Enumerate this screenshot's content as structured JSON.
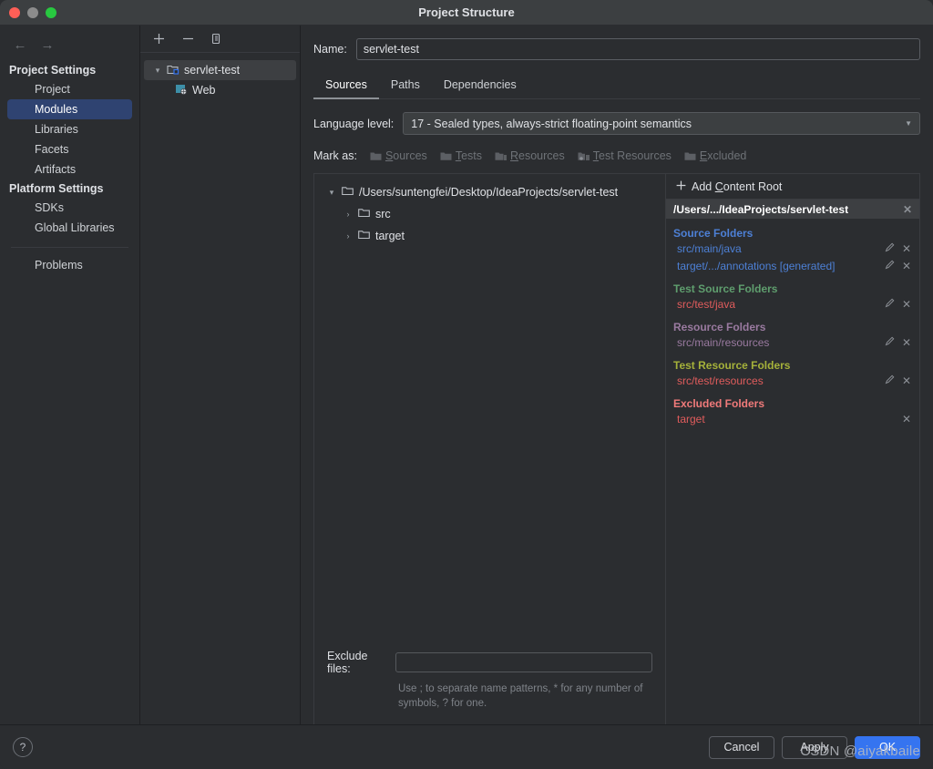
{
  "window": {
    "title": "Project Structure",
    "traffic_lights": [
      "close-button",
      "minimize-button",
      "maximize-button"
    ]
  },
  "sidebar": {
    "back_icon": "←",
    "forward_icon": "→",
    "groups": [
      {
        "label": "Project Settings",
        "items": [
          {
            "label": "Project",
            "selected": false
          },
          {
            "label": "Modules",
            "selected": true
          },
          {
            "label": "Libraries",
            "selected": false
          },
          {
            "label": "Facets",
            "selected": false
          },
          {
            "label": "Artifacts",
            "selected": false
          }
        ]
      },
      {
        "label": "Platform Settings",
        "items": [
          {
            "label": "SDKs",
            "selected": false
          },
          {
            "label": "Global Libraries",
            "selected": false
          }
        ]
      }
    ],
    "problems_label": "Problems"
  },
  "modules_panel": {
    "toolbar": {
      "add_label": "+",
      "remove_label": "−",
      "copy_label": "copy-icon"
    },
    "tree": [
      {
        "label": "servlet-test",
        "level": 1,
        "expanded": true,
        "selected": true,
        "icon": "module-icon"
      },
      {
        "label": "Web",
        "level": 2,
        "expanded": false,
        "selected": false,
        "icon": "web-facet-icon"
      }
    ]
  },
  "main": {
    "name_label": "Name:",
    "name_value": "servlet-test",
    "tabs": [
      {
        "label": "Sources",
        "active": true
      },
      {
        "label": "Paths",
        "active": false
      },
      {
        "label": "Dependencies",
        "active": false
      }
    ],
    "language_level_label": "Language level:",
    "language_level_value": "17 - Sealed types, always-strict floating-point semantics",
    "mark_as_label": "Mark as:",
    "mark_as_buttons": [
      {
        "pre": "",
        "mnemonic": "S",
        "post": "ources",
        "icon": "folder-sources-icon"
      },
      {
        "pre": "",
        "mnemonic": "T",
        "post": "ests",
        "icon": "folder-tests-icon"
      },
      {
        "pre": "",
        "mnemonic": "R",
        "post": "esources",
        "icon": "folder-resources-icon"
      },
      {
        "pre": "",
        "mnemonic": "T",
        "post": "est Resources",
        "icon": "folder-test-resources-icon"
      },
      {
        "pre": "",
        "mnemonic": "E",
        "post": "xcluded",
        "icon": "folder-excluded-icon"
      }
    ],
    "file_tree": [
      {
        "label": "/Users/suntengfei/Desktop/IdeaProjects/servlet-test",
        "level": 1,
        "twisty": "▾"
      },
      {
        "label": "src",
        "level": 2,
        "twisty": "›"
      },
      {
        "label": "target",
        "level": 2,
        "twisty": "›"
      }
    ],
    "exclude_files_label": "Exclude files:",
    "exclude_files_value": "",
    "exclude_hint": "Use ; to separate name patterns, * for any number of symbols, ? for one."
  },
  "content_roots": {
    "add_content_root": {
      "pre": "Add ",
      "mnemonic": "C",
      "post": "ontent Root"
    },
    "root_header": "/Users/.../IdeaProjects/servlet-test",
    "categories": [
      {
        "title": "Source Folders",
        "color": "#4d80d6",
        "paths": [
          {
            "text": "src/main/java",
            "color": "#4d80d6",
            "suffix": "",
            "editable": true,
            "removable": true
          },
          {
            "text": "target/.../annotations",
            "color": "#4d80d6",
            "suffix": " [generated]",
            "editable": true,
            "removable": true
          }
        ]
      },
      {
        "title": "Test Source Folders",
        "color": "#5f9e6e",
        "paths": [
          {
            "text": "src/test/java",
            "color": "#e05c5c",
            "suffix": "",
            "editable": true,
            "removable": true
          }
        ]
      },
      {
        "title": "Resource Folders",
        "color": "#9a7aa0",
        "paths": [
          {
            "text": "src/main/resources",
            "color": "#9a7aa0",
            "suffix": "",
            "editable": true,
            "removable": true
          }
        ]
      },
      {
        "title": "Test Resource Folders",
        "color": "#a5b13a",
        "paths": [
          {
            "text": "src/test/resources",
            "color": "#e05c5c",
            "suffix": "",
            "editable": true,
            "removable": true
          }
        ]
      },
      {
        "title": "Excluded Folders",
        "color": "#f07a7a",
        "paths": [
          {
            "text": "target",
            "color": "#e05c5c",
            "suffix": "",
            "editable": false,
            "removable": true
          }
        ]
      }
    ]
  },
  "footer": {
    "help_label": "?",
    "cancel_label": "Cancel",
    "apply_label": "Apply",
    "ok_label": "OK",
    "watermark": "CSDN @aiyakbaile"
  }
}
